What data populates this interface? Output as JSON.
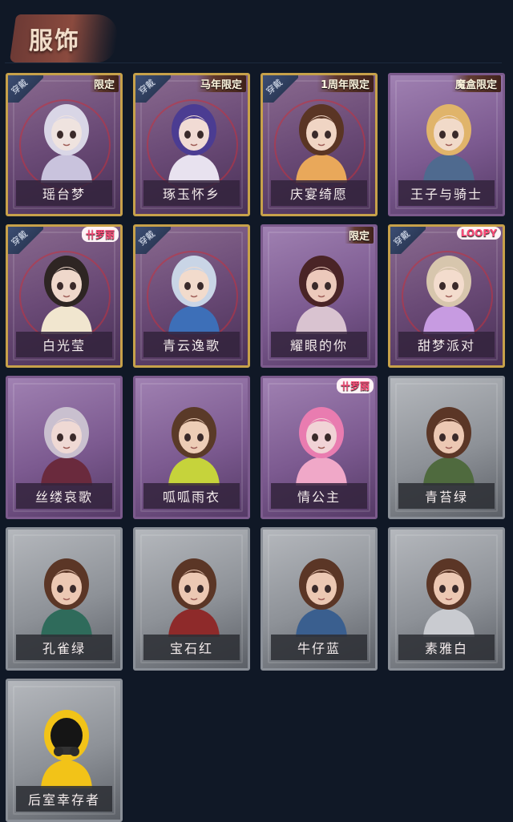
{
  "header": {
    "title": "服饰"
  },
  "wear_label": "穿戴",
  "cards": [
    {
      "name": "瑶台梦",
      "frame": "gold",
      "worn": true,
      "badge": "限定",
      "hair": "#d9d6e6",
      "skin": "#efe3df",
      "outfit": "#c9c3dd"
    },
    {
      "name": "琢玉怀乡",
      "frame": "gold",
      "worn": true,
      "badge": "马年限定",
      "hair": "#4b3c92",
      "skin": "#f1dbd4",
      "outfit": "#e8e2ef"
    },
    {
      "name": "庆宴绮愿",
      "frame": "gold",
      "worn": true,
      "badge": "1周年限定",
      "hair": "#5a3524",
      "skin": "#f0d5c4",
      "outfit": "#e9a85a"
    },
    {
      "name": "王子与骑士",
      "frame": "purple",
      "worn": false,
      "badge": "魔盒限定",
      "hair": "#e0b46a",
      "skin": "#f1dac9",
      "outfit": "#4f6a8f"
    },
    {
      "name": "白光莹",
      "frame": "gold",
      "worn": true,
      "badge": "卄罗丽",
      "hair": "#2e2523",
      "skin": "#efd8cb",
      "outfit": "#f1e6cf"
    },
    {
      "name": "青云逸歌",
      "frame": "gold",
      "worn": true,
      "badge": "",
      "hair": "#c9d5e6",
      "skin": "#f2dbcc",
      "outfit": "#3d6fb8"
    },
    {
      "name": "耀眼的你",
      "frame": "purple",
      "worn": false,
      "badge": "限定",
      "hair": "#4a2426",
      "skin": "#ecc9bb",
      "outfit": "#d9c3d0"
    },
    {
      "name": "甜梦派对",
      "frame": "gold",
      "worn": true,
      "badge": "LOOPY",
      "hair": "#d7c6ad",
      "skin": "#f3dccd",
      "outfit": "#c79be1"
    },
    {
      "name": "丝缕哀歌",
      "frame": "purple",
      "worn": false,
      "badge": "",
      "hair": "#c9c0cf",
      "skin": "#efd9d4",
      "outfit": "#6a2a3d"
    },
    {
      "name": "呱呱雨衣",
      "frame": "purple",
      "worn": false,
      "badge": "",
      "hair": "#5a3a28",
      "skin": "#edcdb6",
      "outfit": "#c6d33b"
    },
    {
      "name": "情公主",
      "frame": "purple",
      "worn": false,
      "badge": "卄罗丽",
      "hair": "#e97cb0",
      "skin": "#f1d3d6",
      "outfit": "#f0a8c8"
    },
    {
      "name": "青苔绿",
      "frame": "gray",
      "worn": false,
      "badge": "",
      "hair": "#5b3626",
      "skin": "#ecc8b3",
      "outfit": "#4f6a3e"
    },
    {
      "name": "孔雀绿",
      "frame": "gray",
      "worn": false,
      "badge": "",
      "hair": "#5b3626",
      "skin": "#ecc8b3",
      "outfit": "#2f6b5b"
    },
    {
      "name": "宝石红",
      "frame": "gray",
      "worn": false,
      "badge": "",
      "hair": "#5b3626",
      "skin": "#ecc8b3",
      "outfit": "#8e2a2a"
    },
    {
      "name": "牛仔蓝",
      "frame": "gray",
      "worn": false,
      "badge": "",
      "hair": "#5b3626",
      "skin": "#ecc8b3",
      "outfit": "#3a5f8f"
    },
    {
      "name": "素雅白",
      "frame": "gray",
      "worn": false,
      "badge": "",
      "hair": "#5b3626",
      "skin": "#ecc8b3",
      "outfit": "#c9cbd0"
    },
    {
      "name": "后室幸存者",
      "frame": "gray",
      "worn": false,
      "badge": "",
      "hair": "#f2c318",
      "skin": "#1c1c1c",
      "outfit": "#f2c318",
      "gasmask": true
    }
  ]
}
